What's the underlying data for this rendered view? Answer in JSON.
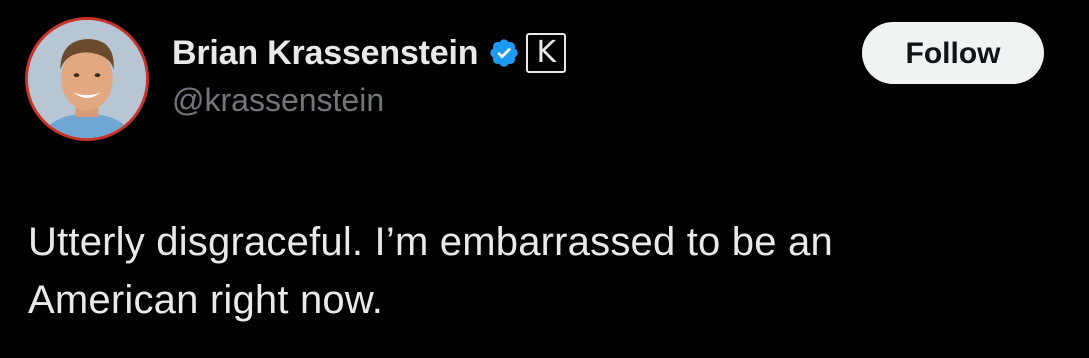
{
  "author": {
    "display_name": "Brian Krassenstein",
    "handle": "@krassenstein",
    "verified_icon": "verified-badge-icon",
    "affiliate_badge_letter": "K",
    "avatar_ring_color": "#c8332a"
  },
  "actions": {
    "follow_label": "Follow"
  },
  "tweet": {
    "text_lines": [
      "Utterly disgraceful. I’m embarrassed to be an",
      "American right now."
    ]
  },
  "colors": {
    "background": "#000000",
    "primary_text": "#e7e9ea",
    "secondary_text": "#71767b",
    "verified_blue": "#1d9bf0",
    "follow_bg": "#eff3f4"
  }
}
